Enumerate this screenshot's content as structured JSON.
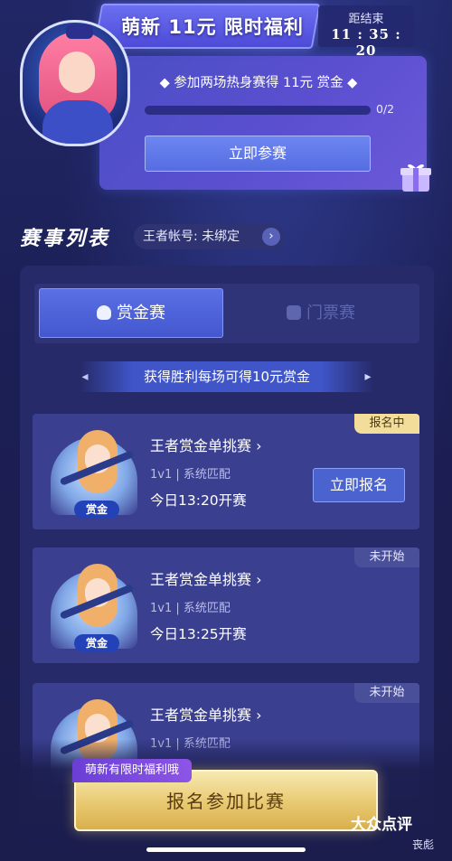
{
  "promo": {
    "title": "萌新 11元 限时福利",
    "countdown_label": "距结束",
    "countdown_time": "11 : 35 : 20",
    "task_text": "◆ 参加两场热身赛得 11元 赏金 ◆",
    "progress_text": "0/2",
    "progress_fraction": 0,
    "join_button": "立即参赛"
  },
  "section": {
    "title": "赛事列表",
    "account_label": "王者帐号: 未绑定"
  },
  "tabs": {
    "bounty": "赏金赛",
    "ticket": "门票赛"
  },
  "banner": {
    "text": "获得胜利每场可得10元赏金"
  },
  "matches": [
    {
      "title": "王者赏金单挑赛 ›",
      "meta": "1v1 | 系统匹配",
      "time": "今日13:20开赛",
      "status": "报名中",
      "badge": "赏金",
      "signup_button": "立即报名"
    },
    {
      "title": "王者赏金单挑赛 ›",
      "meta": "1v1 | 系统匹配",
      "time": "今日13:25开赛",
      "status": "未开始",
      "badge": "赏金"
    },
    {
      "title": "王者赏金单挑赛 ›",
      "meta": "1v1 | 系统匹配",
      "status": "未开始"
    }
  ],
  "bottom": {
    "newbie_tag": "萌新有限时福利哦",
    "register_button": "报名参加比赛",
    "watermark": "大众点评",
    "watermark_user": "丧彪"
  },
  "colors": {
    "background": "#1c1f52",
    "accent": "#4b63cf",
    "gold": "#e8c971",
    "status_open": "#f2dd9a"
  },
  "icons": [
    "gift-icon",
    "bounty-bag-icon",
    "ticket-icon",
    "chevron-right-icon",
    "arrow-left-icon",
    "arrow-right-icon"
  ]
}
